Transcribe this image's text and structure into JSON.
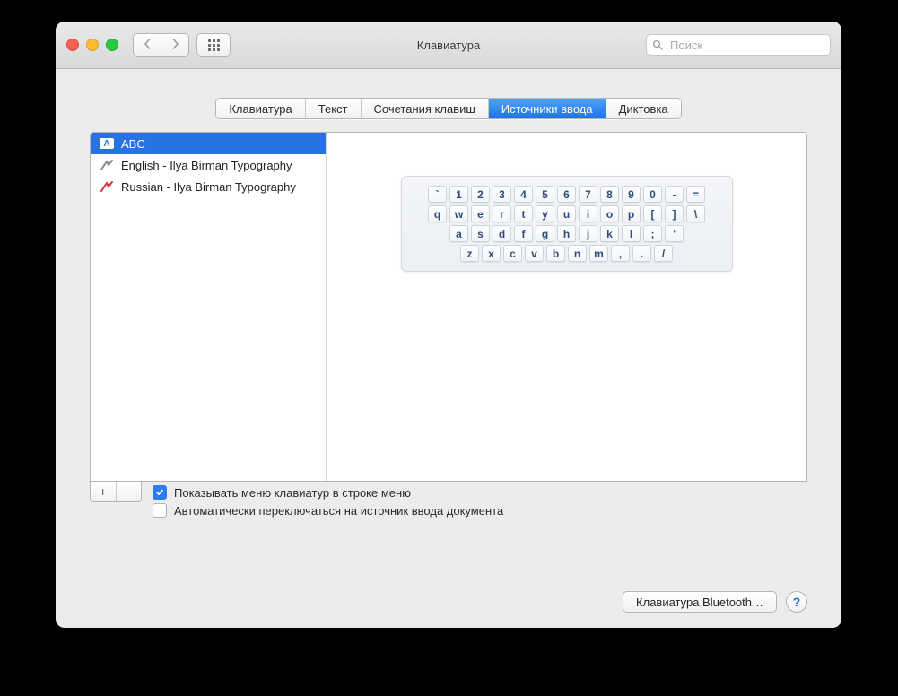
{
  "window": {
    "title": "Клавиатура"
  },
  "search": {
    "placeholder": "Поиск"
  },
  "tabs": [
    {
      "label": "Клавиатура",
      "active": false
    },
    {
      "label": "Текст",
      "active": false
    },
    {
      "label": "Сочетания клавиш",
      "active": false
    },
    {
      "label": "Источники ввода",
      "active": true
    },
    {
      "label": "Диктовка",
      "active": false
    }
  ],
  "sources": [
    {
      "label": "ABC",
      "icon": "abc-flag",
      "selected": true
    },
    {
      "label": "English - Ilya Birman Typography",
      "icon": "birman-gray",
      "selected": false
    },
    {
      "label": "Russian - Ilya Birman Typography",
      "icon": "birman-red",
      "selected": false
    }
  ],
  "keyboard_preview": {
    "row0": [
      "`",
      "1",
      "2",
      "3",
      "4",
      "5",
      "6",
      "7",
      "8",
      "9",
      "0",
      "-",
      "="
    ],
    "row1": [
      "q",
      "w",
      "e",
      "r",
      "t",
      "y",
      "u",
      "i",
      "o",
      "p",
      "[",
      "]",
      "\\"
    ],
    "row2": [
      "a",
      "s",
      "d",
      "f",
      "g",
      "h",
      "j",
      "k",
      "l",
      ";",
      "'"
    ],
    "row3": [
      "z",
      "x",
      "c",
      "v",
      "b",
      "n",
      "m",
      ",",
      ".",
      "/"
    ]
  },
  "options": {
    "show_menu": {
      "label": "Показывать меню клавиатур в строке меню",
      "checked": true
    },
    "auto_switch": {
      "label": "Автоматически переключаться на источник ввода документа",
      "checked": false
    }
  },
  "footer": {
    "bluetooth_button": "Клавиатура Bluetooth…"
  },
  "add_remove": {
    "add": "+",
    "remove": "−"
  }
}
